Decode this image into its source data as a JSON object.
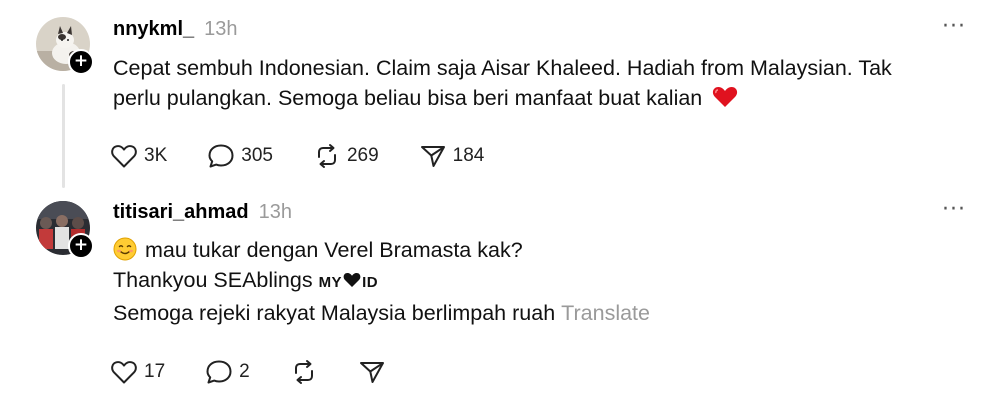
{
  "post1": {
    "username": "nnykml_",
    "time": "13h",
    "more": "···",
    "text_line1": "Cepat sembuh Indonesian. Claim saja Aisar Khaleed. Hadiah from Malaysian. Tak",
    "text_line2": "perlu pulangkan. Semoga beliau bisa beri manfaat buat kalian",
    "likes": "3K",
    "replies": "305",
    "reposts": "269",
    "shares": "184"
  },
  "post2": {
    "username": "titisari_ahmad",
    "time": "13h",
    "more": "···",
    "line1": "mau tukar dengan Verel Bramasta kak?",
    "line2_prefix": "Thankyou SEAblings ",
    "line2_my": "MY",
    "line2_id": "ID",
    "line3": "Semoga rejeki rakyat Malaysia berlimpah ruah",
    "translate": "Translate",
    "likes": "17",
    "replies": "2"
  },
  "icons": {
    "plus": "+",
    "heart_color": "#e0121f"
  }
}
